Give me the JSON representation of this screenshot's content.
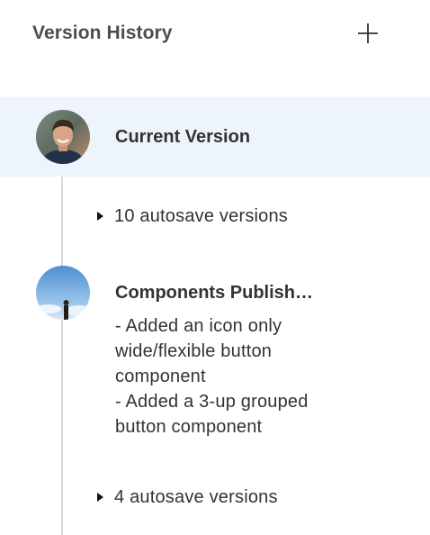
{
  "header": {
    "title": "Version History",
    "add_icon": "plus-icon"
  },
  "versions": [
    {
      "title": "Current Version",
      "avatar": "user-avatar-portrait"
    },
    {
      "title": "Components Publish…",
      "avatar": "user-avatar-landscape",
      "description_lines": [
        "- Added an icon only",
        "wide/flexible button",
        "component",
        "- Added a 3-up grouped",
        "button component"
      ]
    }
  ],
  "autosave_groups": [
    {
      "label": "10 autosave versions",
      "icon": "caret-right-icon"
    },
    {
      "label": "4 autosave versions",
      "icon": "caret-right-icon"
    }
  ],
  "colors": {
    "selected_background": "#edf4fb",
    "timeline": "#d8d8d8",
    "text": "#333333"
  }
}
